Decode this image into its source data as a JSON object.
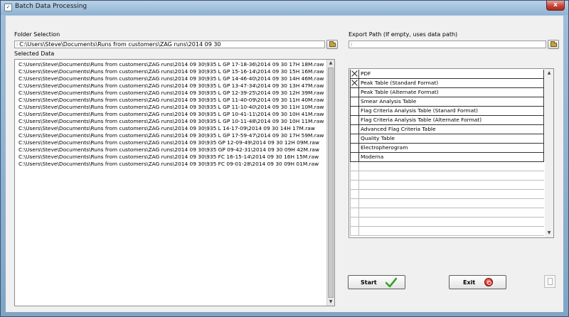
{
  "window": {
    "title": "Batch Data Processing",
    "icon": "app-icon",
    "close_label": "x"
  },
  "folder_selection": {
    "label": "Folder Selection",
    "value": "C:\\Users\\Steve\\Documents\\Runs from customers\\ZAG runs\\2014 09 30",
    "browse_icon": "folder-icon"
  },
  "export_path": {
    "label": "Export Path (If empty, uses data path)",
    "value": "",
    "browse_icon": "folder-icon"
  },
  "selected_data": {
    "label": "Selected Data",
    "items": [
      "C:\\Users\\Steve\\Documents\\Runs from customers\\ZAG runs\\2014 09 30\\935 L GP 17-18-36\\2014 09 30 17H 18M.raw",
      "C:\\Users\\Steve\\Documents\\Runs from customers\\ZAG runs\\2014 09 30\\935 L GP 15-16-14\\2014 09 30 15H 16M.raw",
      "C:\\Users\\Steve\\Documents\\Runs from customers\\ZAG runs\\2014 09 30\\935 L GP 14-46-40\\2014 09 30 14H 46M.raw",
      "C:\\Users\\Steve\\Documents\\Runs from customers\\ZAG runs\\2014 09 30\\935 L GP 13-47-34\\2014 09 30 13H 47M.raw",
      "C:\\Users\\Steve\\Documents\\Runs from customers\\ZAG runs\\2014 09 30\\935 L GP 12-39-25\\2014 09 30 12H 39M.raw",
      "C:\\Users\\Steve\\Documents\\Runs from customers\\ZAG runs\\2014 09 30\\935 L GP 11-40-09\\2014 09 30 11H 40M.raw",
      "C:\\Users\\Steve\\Documents\\Runs from customers\\ZAG runs\\2014 09 30\\935 L GP 11-10-40\\2014 09 30 11H 10M.raw",
      "C:\\Users\\Steve\\Documents\\Runs from customers\\ZAG runs\\2014 09 30\\935 L GP 10-41-11\\2014 09 30 10H 41M.raw",
      "C:\\Users\\Steve\\Documents\\Runs from customers\\ZAG runs\\2014 09 30\\935 L GP 10-11-48\\2014 09 30 10H 11M.raw",
      "C:\\Users\\Steve\\Documents\\Runs from customers\\ZAG runs\\2014 09 30\\935 L 14-17-09\\2014 09 30 14H 17M.raw",
      "C:\\Users\\Steve\\Documents\\Runs from customers\\ZAG runs\\2014 09 30\\935 L  GP 17-59-47\\2014 09 30 17H 59M.raw",
      "C:\\Users\\Steve\\Documents\\Runs from customers\\ZAG runs\\2014 09 30\\935 GP 12-09-49\\2014 09 30 12H 09M.raw",
      "C:\\Users\\Steve\\Documents\\Runs from customers\\ZAG runs\\2014 09 30\\935 GP 09-42-31\\2014 09 30 09H 42M.raw",
      "C:\\Users\\Steve\\Documents\\Runs from customers\\ZAG runs\\2014 09 30\\935 FC 16-15-14\\2014 09 30 16H 15M.raw",
      "C:\\Users\\Steve\\Documents\\Runs from customers\\ZAG runs\\2014 09 30\\935 FC 09-01-28\\2014 09 30 09H 01M.raw"
    ]
  },
  "export_options": {
    "rows": [
      {
        "label": "PDF",
        "checked": true
      },
      {
        "label": "Peak Table (Standard Format)",
        "checked": true
      },
      {
        "label": "Peak Table (Alternate Format)",
        "checked": false
      },
      {
        "label": "Smear Analysis Table",
        "checked": false
      },
      {
        "label": "Flag Criteria Analysis Table (Stanard Format)",
        "checked": false
      },
      {
        "label": "Flag Criteria Analysis Table (Alternate Format)",
        "checked": false
      },
      {
        "label": "Advanced Flag Criteria Table",
        "checked": false
      },
      {
        "label": "Quality Table",
        "checked": false
      },
      {
        "label": "Electropherogram",
        "checked": false
      },
      {
        "label": "Moderna",
        "checked": false
      }
    ],
    "empty_rows": 8
  },
  "buttons": {
    "start_label": "Start",
    "start_icon": "checkmark-icon",
    "start_icon_color": "#3aa02a",
    "exit_label": "Exit",
    "exit_icon": "power-icon",
    "exit_icon_color": "#d7271a",
    "report_icon": "document-icon"
  }
}
